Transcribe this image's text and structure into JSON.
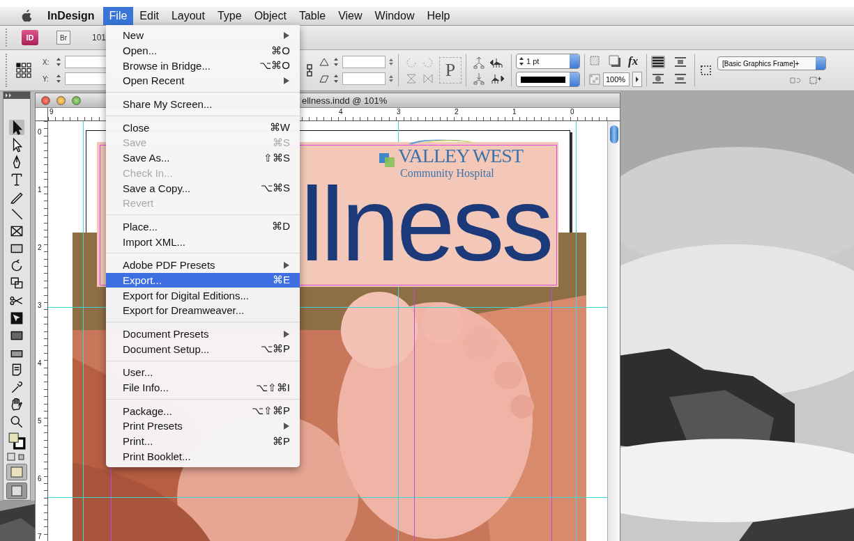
{
  "menubar": {
    "app_name": "InDesign",
    "items": [
      {
        "label": "File",
        "selected": true
      },
      {
        "label": "Edit",
        "selected": false
      },
      {
        "label": "Layout",
        "selected": false
      },
      {
        "label": "Type",
        "selected": false
      },
      {
        "label": "Object",
        "selected": false
      },
      {
        "label": "Table",
        "selected": false
      },
      {
        "label": "View",
        "selected": false
      },
      {
        "label": "Window",
        "selected": false
      },
      {
        "label": "Help",
        "selected": false
      }
    ]
  },
  "app_bar": {
    "buttons": [
      "ID",
      "Br"
    ],
    "zoom": "101"
  },
  "control_panel": {
    "x_label": "X:",
    "y_label": "Y:",
    "proxy_glyph": "P",
    "stroke_weight": "1 pt",
    "effects_glyph": "fx",
    "opacity": "100%",
    "object_style": "[Basic Graphics Frame]+"
  },
  "file_menu": {
    "groups": [
      {
        "items": [
          {
            "label": "New",
            "submenu": true,
            "disabled": false,
            "selected": false
          },
          {
            "label": "Open...",
            "shortcut": "⌘O",
            "submenu": false,
            "disabled": false,
            "selected": false
          },
          {
            "label": "Browse in Bridge...",
            "shortcut": "⌥⌘O",
            "submenu": false,
            "disabled": false,
            "selected": false
          },
          {
            "label": "Open Recent",
            "submenu": true,
            "disabled": false,
            "selected": false
          }
        ]
      },
      {
        "items": [
          {
            "label": "Share My Screen...",
            "submenu": false,
            "disabled": false,
            "selected": false
          }
        ]
      },
      {
        "items": [
          {
            "label": "Close",
            "shortcut": "⌘W",
            "submenu": false,
            "disabled": false,
            "selected": false
          },
          {
            "label": "Save",
            "shortcut": "⌘S",
            "submenu": false,
            "disabled": true,
            "selected": false
          },
          {
            "label": "Save As...",
            "shortcut": "⇧⌘S",
            "submenu": false,
            "disabled": false,
            "selected": false
          },
          {
            "label": "Check In...",
            "submenu": false,
            "disabled": true,
            "selected": false
          },
          {
            "label": "Save a Copy...",
            "shortcut": "⌥⌘S",
            "submenu": false,
            "disabled": false,
            "selected": false
          },
          {
            "label": "Revert",
            "submenu": false,
            "disabled": true,
            "selected": false
          }
        ]
      },
      {
        "items": [
          {
            "label": "Place...",
            "shortcut": "⌘D",
            "submenu": false,
            "disabled": false,
            "selected": false
          },
          {
            "label": "Import XML...",
            "submenu": false,
            "disabled": false,
            "selected": false
          }
        ]
      },
      {
        "items": [
          {
            "label": "Adobe PDF Presets",
            "submenu": true,
            "disabled": false,
            "selected": false
          },
          {
            "label": "Export...",
            "shortcut": "⌘E",
            "submenu": false,
            "disabled": false,
            "selected": true
          },
          {
            "label": "Export for Digital Editions...",
            "submenu": false,
            "disabled": false,
            "selected": false
          },
          {
            "label": "Export for Dreamweaver...",
            "submenu": false,
            "disabled": false,
            "selected": false
          }
        ]
      },
      {
        "items": [
          {
            "label": "Document Presets",
            "submenu": true,
            "disabled": false,
            "selected": false
          },
          {
            "label": "Document Setup...",
            "shortcut": "⌥⌘P",
            "submenu": false,
            "disabled": false,
            "selected": false
          }
        ]
      },
      {
        "items": [
          {
            "label": "User...",
            "submenu": false,
            "disabled": false,
            "selected": false
          },
          {
            "label": "File Info...",
            "shortcut": "⌥⇧⌘I",
            "submenu": false,
            "disabled": false,
            "selected": false
          }
        ]
      },
      {
        "items": [
          {
            "label": "Package...",
            "shortcut": "⌥⇧⌘P",
            "submenu": false,
            "disabled": false,
            "selected": false
          },
          {
            "label": "Print Presets",
            "submenu": true,
            "disabled": false,
            "selected": false
          },
          {
            "label": "Print...",
            "shortcut": "⌘P",
            "submenu": false,
            "disabled": false,
            "selected": false
          },
          {
            "label": "Print Booklet...",
            "submenu": false,
            "disabled": false,
            "selected": false
          }
        ]
      }
    ]
  },
  "document": {
    "title": "ellness.indd @ 101%",
    "ruler_labels": [
      "9",
      "4",
      "3",
      "2",
      "1",
      "0"
    ],
    "vertical_ruler_labels": [
      "0",
      "1",
      "2",
      "3",
      "4",
      "5",
      "6",
      "7"
    ],
    "heading": "llness",
    "logo": {
      "name": "VALLEY WEST",
      "subtitle": "Community Hospital"
    }
  }
}
